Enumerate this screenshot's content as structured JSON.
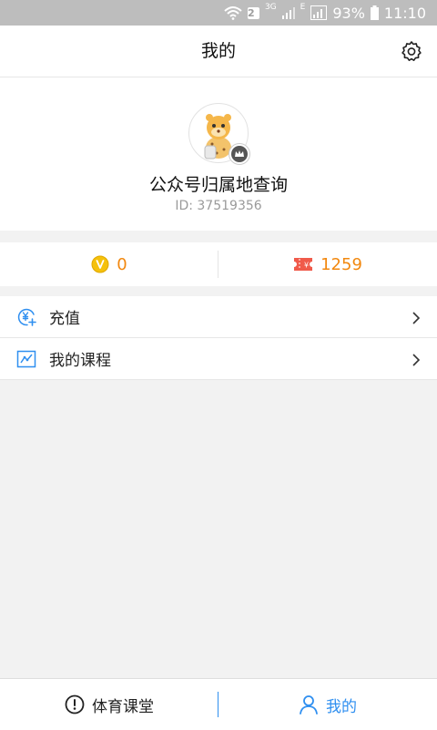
{
  "status_bar": {
    "wifi_badge": "2",
    "network_3g": "3G",
    "network_e": "E",
    "battery": "93%",
    "time": "11:10"
  },
  "header": {
    "title": "我的",
    "settings_icon": "gear-icon"
  },
  "profile": {
    "avatar_icon": "cartoon-leopard-avatar",
    "nickname": "公众号归属地查询",
    "id_text": "ID: 37519356"
  },
  "stats": {
    "coins": {
      "icon": "coin-icon",
      "value": "0"
    },
    "tickets": {
      "icon": "ticket-icon",
      "value": "1259"
    }
  },
  "menu": {
    "items": [
      {
        "icon": "recharge-yuan-icon",
        "label": "充值"
      },
      {
        "icon": "course-chart-icon",
        "label": "我的课程"
      }
    ]
  },
  "bottom_nav": {
    "items": [
      {
        "icon": "info-circle-icon",
        "label": "体育课堂",
        "active": false
      },
      {
        "icon": "person-icon",
        "label": "我的",
        "active": true
      }
    ]
  },
  "colors": {
    "accent": "#2f8ff0",
    "stat_orange": "#f2880f",
    "coin_yellow": "#f5c10b",
    "ticket_red": "#f05a4a",
    "status_bar_bg": "#bdbdbd",
    "page_bg": "#f2f2f2"
  }
}
